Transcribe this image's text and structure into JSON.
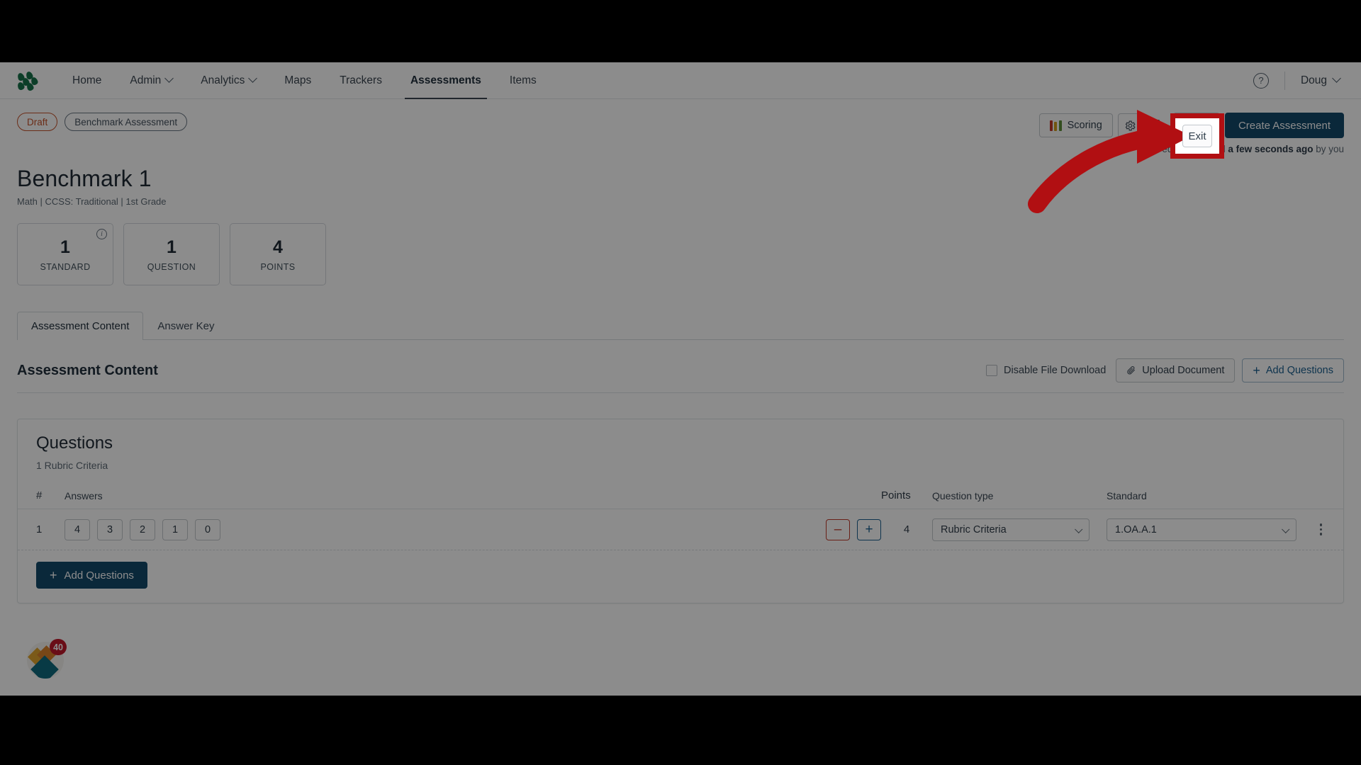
{
  "nav": {
    "logo_name": "product-logo",
    "items": [
      {
        "label": "Home",
        "has_caret": false,
        "active": false
      },
      {
        "label": "Admin",
        "has_caret": true,
        "active": false
      },
      {
        "label": "Analytics",
        "has_caret": true,
        "active": false
      },
      {
        "label": "Maps",
        "has_caret": false,
        "active": false
      },
      {
        "label": "Trackers",
        "has_caret": false,
        "active": false
      },
      {
        "label": "Assessments",
        "has_caret": false,
        "active": true
      },
      {
        "label": "Items",
        "has_caret": false,
        "active": false
      }
    ],
    "help_glyph": "?",
    "user_name": "Doug"
  },
  "header": {
    "status_pill": "Draft",
    "type_pill": "Benchmark Assessment",
    "scoring_label": "Scoring",
    "settings_icon": "gear-icon",
    "kebab_icon": "more-vertical-icon",
    "exit_label": "Exit",
    "create_label": "Create Assessment",
    "saved_prefix": "Last edit was saved ",
    "saved_strong": "a few seconds ago",
    "saved_suffix": " by you",
    "title": "Benchmark 1",
    "subtitle": "Math  |  CCSS: Traditional  |  1st Grade"
  },
  "stats": [
    {
      "value": "1",
      "label": "STANDARD",
      "info": true
    },
    {
      "value": "1",
      "label": "QUESTION",
      "info": false
    },
    {
      "value": "4",
      "label": "POINTS",
      "info": false
    }
  ],
  "tabs": [
    {
      "label": "Assessment Content",
      "active": true
    },
    {
      "label": "Answer Key",
      "active": false
    }
  ],
  "content": {
    "heading": "Assessment Content",
    "disable_download_label": "Disable File Download",
    "disable_download_checked": false,
    "upload_label": "Upload Document",
    "add_questions_label": "Add Questions"
  },
  "questions_card": {
    "title": "Questions",
    "subtitle": "1 Rubric Criteria",
    "columns": {
      "num": "#",
      "answers": "Answers",
      "points": "Points",
      "qtype": "Question type",
      "standard": "Standard"
    },
    "rows": [
      {
        "num": "1",
        "answers": [
          "4",
          "3",
          "2",
          "1",
          "0"
        ],
        "minus": "–",
        "plus": "+",
        "points": "4",
        "qtype": "Rubric Criteria",
        "standard": "1.OA.A.1"
      }
    ],
    "add_questions_label": "Add Questions"
  },
  "widget": {
    "badge_count": "40"
  },
  "colors": {
    "brand_navy": "#13496b",
    "logo_green": "#16724a",
    "draft_orange": "#c4522b",
    "link_blue": "#1b5f8f",
    "danger_red": "#c0392b",
    "annotation_red": "#b10f12",
    "badge_red": "#c0182b"
  }
}
